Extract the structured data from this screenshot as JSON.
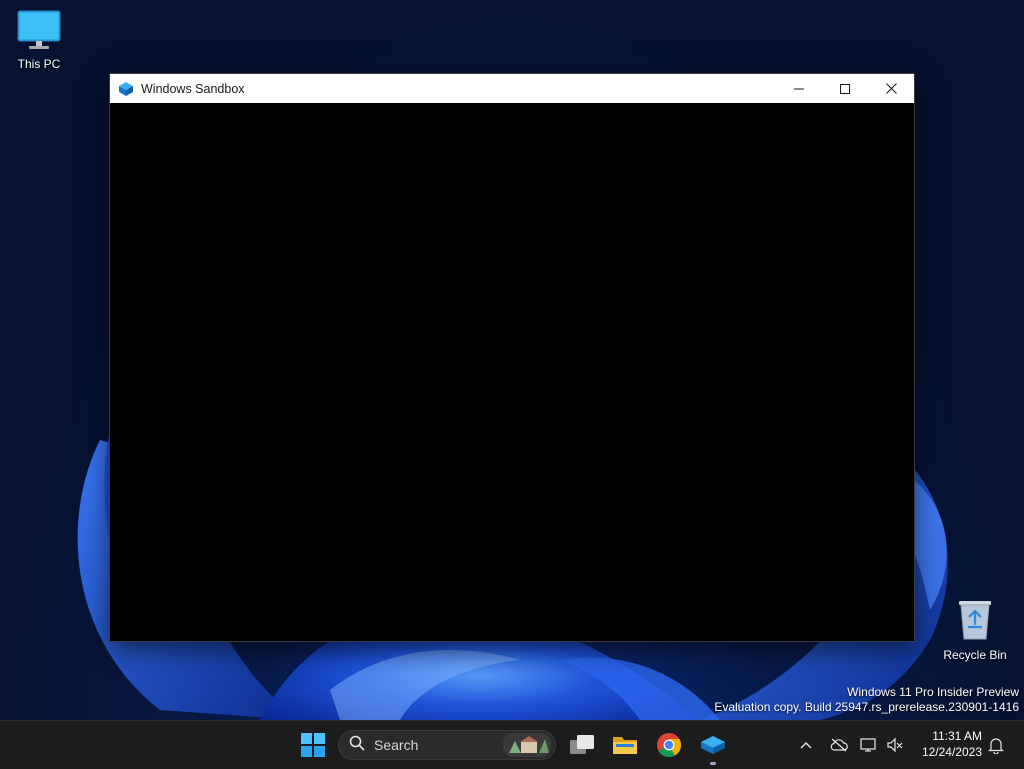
{
  "desktop": {
    "icons": [
      {
        "label": "This PC",
        "icon": "monitor-icon"
      },
      {
        "label": "Recycle Bin",
        "icon": "recycle-bin-icon"
      }
    ],
    "watermark": {
      "line1": "Windows 11 Pro Insider Preview",
      "line2": "Evaluation copy. Build 25947.rs_prerelease.230901-1416"
    }
  },
  "window": {
    "title": "Windows Sandbox",
    "icon": "sandbox-icon",
    "buttons": {
      "minimize": "minimize-icon",
      "maximize": "maximize-icon",
      "close": "close-icon"
    }
  },
  "taskbar": {
    "search_placeholder": "Search",
    "apps": [
      {
        "name": "Task View",
        "icon": "task-view-icon"
      },
      {
        "name": "File Explorer",
        "icon": "folder-icon"
      },
      {
        "name": "Google Chrome",
        "icon": "chrome-icon"
      },
      {
        "name": "Windows Sandbox",
        "icon": "sandbox-icon",
        "running": true
      }
    ],
    "tray": {
      "time": "11:31 AM",
      "date": "12/24/2023"
    }
  },
  "colors": {
    "taskbar_bg": "#1c1c1c",
    "window_client_bg": "#000000",
    "titlebar_bg": "#ffffff",
    "wallpaper_accent": "#1a4bd6"
  }
}
